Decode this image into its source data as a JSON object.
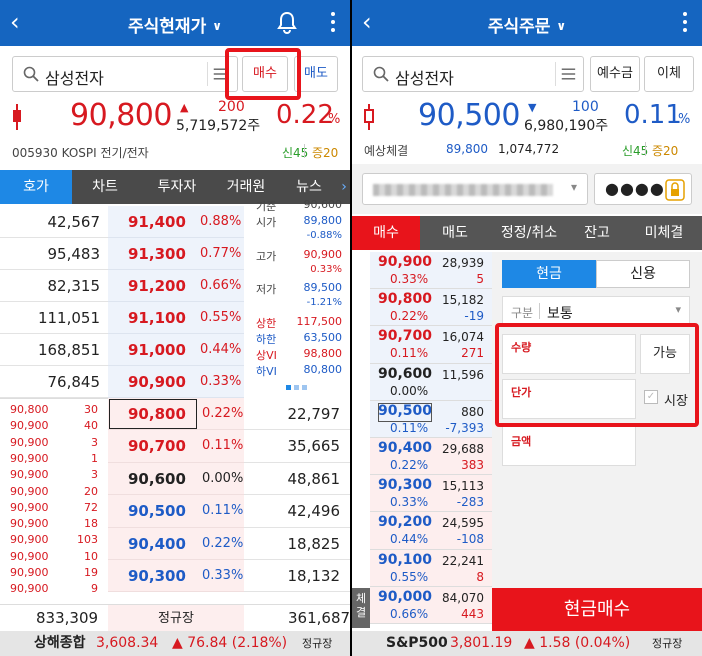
{
  "left": {
    "title": "주식현재가",
    "search": {
      "name": "삼성전자"
    },
    "buy_button": "매수",
    "sell_button": "매도",
    "price": "90,800",
    "change": "200",
    "volume": "5,719,572주",
    "change_pct": "0.22",
    "pct_unit": "%",
    "info_line": "005930 KOSPI 전기/전자",
    "credit": "신45",
    "margin": "증20",
    "tabs": [
      "호가",
      "차트",
      "투자자",
      "거래원",
      "뉴스"
    ],
    "sell_rows": [
      {
        "qty": "42,567",
        "price": "91,400",
        "pct": "0.88%"
      },
      {
        "qty": "95,483",
        "price": "91,300",
        "pct": "0.77%"
      },
      {
        "qty": "82,315",
        "price": "91,200",
        "pct": "0.66%"
      },
      {
        "qty": "111,051",
        "price": "91,100",
        "pct": "0.55%"
      },
      {
        "qty": "168,851",
        "price": "91,000",
        "pct": "0.44%"
      },
      {
        "qty": "76,845",
        "price": "90,900",
        "pct": "0.33%"
      }
    ],
    "info_panel": [
      {
        "label": "기준",
        "value": "90,600",
        "sub": ""
      },
      {
        "label": "시가",
        "value": "89,800",
        "sub": "-0.88%"
      },
      {
        "label": "고가",
        "value": "90,900",
        "sub": "0.33%"
      },
      {
        "label": "저가",
        "value": "89,500",
        "sub": "-1.21%"
      },
      {
        "label": "상한",
        "value": "117,500",
        "sub": ""
      },
      {
        "label": "하한",
        "value": "63,500",
        "sub": ""
      },
      {
        "label": "상VI",
        "value": "98,800",
        "sub": ""
      },
      {
        "label": "하VI",
        "value": "80,800",
        "sub": ""
      }
    ],
    "ticks": [
      {
        "price": "90,800",
        "qty": "30"
      },
      {
        "price": "90,900",
        "qty": "40"
      },
      {
        "price": "90,900",
        "qty": "3"
      },
      {
        "price": "90,900",
        "qty": "1"
      },
      {
        "price": "90,900",
        "qty": "3"
      },
      {
        "price": "90,900",
        "qty": "20"
      },
      {
        "price": "90,900",
        "qty": "72"
      },
      {
        "price": "90,900",
        "qty": "18"
      },
      {
        "price": "90,900",
        "qty": "103"
      },
      {
        "price": "90,900",
        "qty": "10"
      },
      {
        "price": "90,900",
        "qty": "19"
      },
      {
        "price": "90,900",
        "qty": "9"
      }
    ],
    "buy_rows": [
      {
        "price": "90,800",
        "pct": "0.22%",
        "qty": "22,797"
      },
      {
        "price": "90,700",
        "pct": "0.11%",
        "qty": "35,665"
      },
      {
        "price": "90,600",
        "pct": "0.00%",
        "qty": "48,861"
      },
      {
        "price": "90,500",
        "pct": "0.11%",
        "qty": "42,496"
      },
      {
        "price": "90,400",
        "pct": "0.22%",
        "qty": "18,825"
      },
      {
        "price": "90,300",
        "pct": "0.33%",
        "qty": "18,132"
      }
    ],
    "total_sell": "833,309",
    "session": "정규장",
    "total_buy": "361,687",
    "index_name": "상해종합",
    "index_value": "3,608.34",
    "index_change": "▲ 76.84 (2.18%)",
    "index_session": "정규장"
  },
  "right": {
    "title": "주식주문",
    "search": {
      "name": "삼성전자"
    },
    "deposit_button": "예수금",
    "transfer_button": "이체",
    "price": "90,500",
    "change": "100",
    "volume": "6,980,190주",
    "change_pct": "0.11",
    "pct_unit": "%",
    "expected_label": "예상체결",
    "expected_price": "89,800",
    "expected_volume": "1,074,772",
    "credit": "신45",
    "margin": "증20",
    "password_mask": "●●●●",
    "tabs": [
      "매수",
      "매도",
      "정정/취소",
      "잔고",
      "미체결"
    ],
    "book": [
      {
        "price": "90,900",
        "pct": "0.33%",
        "qty": "28,939",
        "chg": "5",
        "side": "sell"
      },
      {
        "price": "90,800",
        "pct": "0.22%",
        "qty": "15,182",
        "chg": "-19",
        "side": "sell"
      },
      {
        "price": "90,700",
        "pct": "0.11%",
        "qty": "16,074",
        "chg": "271",
        "side": "sell"
      },
      {
        "price": "90,600",
        "pct": "0.00%",
        "qty": "11,596",
        "chg": "",
        "side": "sell"
      },
      {
        "price": "90,500",
        "pct": "0.11%",
        "qty": "880",
        "chg": "-7,393",
        "side": "sell"
      },
      {
        "price": "90,400",
        "pct": "0.22%",
        "qty": "29,688",
        "chg": "383",
        "side": "buy"
      },
      {
        "price": "90,300",
        "pct": "0.33%",
        "qty": "15,113",
        "chg": "-283",
        "side": "buy"
      },
      {
        "price": "90,200",
        "pct": "0.44%",
        "qty": "24,595",
        "chg": "-108",
        "side": "buy"
      },
      {
        "price": "90,100",
        "pct": "0.55%",
        "qty": "22,241",
        "chg": "8",
        "side": "buy"
      },
      {
        "price": "90,000",
        "pct": "0.66%",
        "qty": "84,070",
        "chg": "443",
        "side": "buy"
      }
    ],
    "side_tab": "체결",
    "order_type_cash": "현금",
    "order_type_credit": "신용",
    "kind_label": "구분",
    "kind_value": "보통",
    "qty_label": "수량",
    "qty_button": "가능",
    "price_label": "단가",
    "market_checkbox": "시장",
    "amount_label": "금액",
    "submit": "현금매수",
    "index_name": "S&P500",
    "index_value": "3,801.19",
    "index_change": "▲ 1.58 (0.04%)",
    "index_session": "정규장"
  }
}
